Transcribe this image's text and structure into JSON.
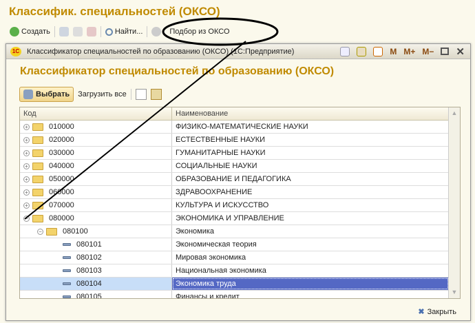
{
  "page_title": "Классифик. специальностей (ОКСО)",
  "toolbar": {
    "create": "Создать",
    "find": "Найти...",
    "pick": "Подбор из ОКСО"
  },
  "window": {
    "title": "Классификатор специальностей по образованию (ОКСО) (1С:Предприятие)",
    "m": "M",
    "mplus": "M+",
    "mminus": "M−",
    "heading": "Классификатор специальностей по образованию (ОКСО)",
    "select": "Выбрать",
    "load_all": "Загрузить все",
    "close": "Закрыть"
  },
  "table": {
    "headers": [
      "Код",
      "Наименование"
    ],
    "rows": [
      {
        "code": "010000",
        "name": "ФИЗИКО-МАТЕМАТИЧЕСКИЕ НАУКИ",
        "level": 0,
        "type": "folder",
        "exp": "+"
      },
      {
        "code": "020000",
        "name": "ЕСТЕСТВЕННЫЕ НАУКИ",
        "level": 0,
        "type": "folder",
        "exp": "+"
      },
      {
        "code": "030000",
        "name": "ГУМАНИТАРНЫЕ НАУКИ",
        "level": 0,
        "type": "folder",
        "exp": "+"
      },
      {
        "code": "040000",
        "name": "СОЦИАЛЬНЫЕ НАУКИ",
        "level": 0,
        "type": "folder",
        "exp": "+"
      },
      {
        "code": "050000",
        "name": "ОБРАЗОВАНИЕ И ПЕДАГОГИКА",
        "level": 0,
        "type": "folder",
        "exp": "+"
      },
      {
        "code": "060000",
        "name": "ЗДРАВООХРАНЕНИЕ",
        "level": 0,
        "type": "folder",
        "exp": "+"
      },
      {
        "code": "070000",
        "name": "КУЛЬТУРА И ИСКУССТВО",
        "level": 0,
        "type": "folder",
        "exp": "+"
      },
      {
        "code": "080000",
        "name": "ЭКОНОМИКА И УПРАВЛЕНИЕ",
        "level": 0,
        "type": "folder",
        "exp": "−"
      },
      {
        "code": "080100",
        "name": "Экономика",
        "level": 1,
        "type": "folder",
        "exp": "−"
      },
      {
        "code": "080101",
        "name": "Экономическая теория",
        "level": 2,
        "type": "leaf"
      },
      {
        "code": "080102",
        "name": "Мировая экономика",
        "level": 2,
        "type": "leaf"
      },
      {
        "code": "080103",
        "name": "Национальная экономика",
        "level": 2,
        "type": "leaf"
      },
      {
        "code": "080104",
        "name": "Экономика труда",
        "level": 2,
        "type": "leaf",
        "selected": true
      },
      {
        "code": "080105",
        "name": "Финансы и кредит",
        "level": 2,
        "type": "leaf"
      }
    ]
  }
}
